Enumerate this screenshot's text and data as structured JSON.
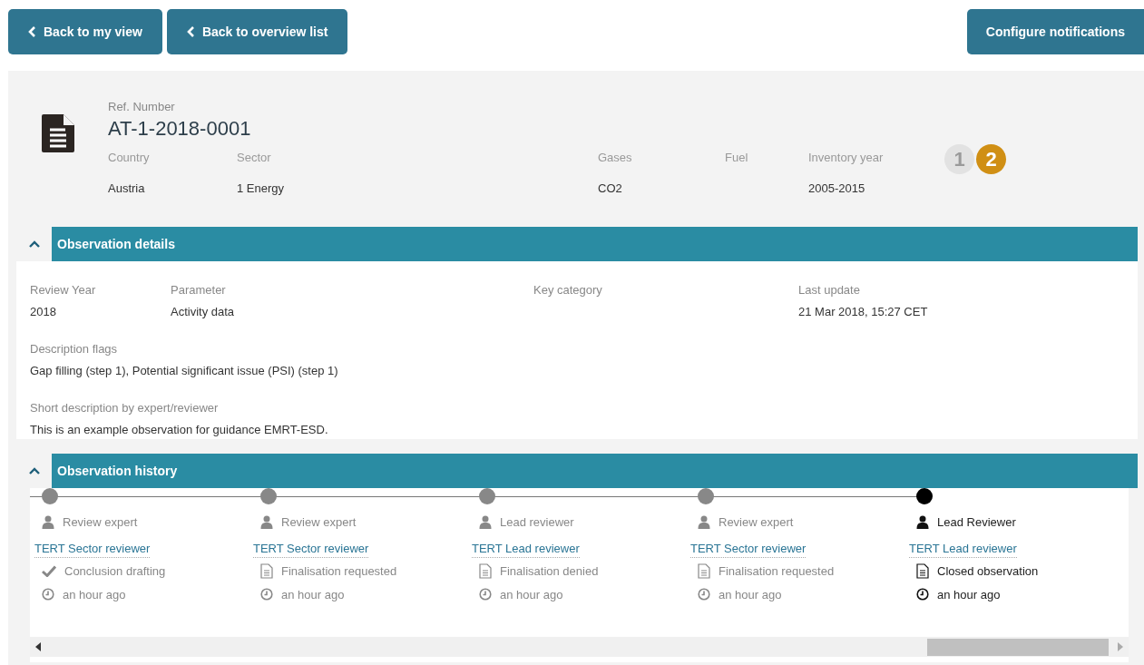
{
  "nav_buttons": [
    "Back to my view",
    "Back to overview list"
  ],
  "configure_button": "Configure notifications",
  "header": {
    "ref_label": "Ref. Number",
    "ref_number": "AT-1-2018-0001",
    "fields": [
      {
        "label": "Country",
        "value": "Austria"
      },
      {
        "label": "Sector",
        "value": "1 Energy"
      },
      {
        "label": "Gases",
        "value": "CO2"
      },
      {
        "label": "Fuel"
      },
      {
        "label": "Inventory year",
        "value": "2005-2015"
      }
    ],
    "steps": [
      {
        "label": "1",
        "selected": false
      },
      {
        "label": "2",
        "selected": true
      }
    ]
  },
  "details": {
    "title": "Observation details",
    "expanded": true,
    "fields": [
      {
        "label": "Review Year",
        "value": "2018"
      },
      {
        "label": "Parameter",
        "value": "Activity data"
      },
      {
        "label": "Key category"
      },
      {
        "label": "Last update",
        "value": "21 Mar 2018, 15:27 CET"
      }
    ],
    "flags_label": "Description flags",
    "flags": "Gap filling (step 1), Potential significant issue (PSI) (step 1)",
    "short_label": "Short description by expert/reviewer",
    "short": "This is an example observation for guidance EMRT-ESD."
  },
  "history": {
    "title": "Observation history",
    "expanded": true,
    "events": [
      {
        "role": "Review expert",
        "user": "TERT Sector reviewer",
        "kind": "check",
        "action": "Conclusion drafting",
        "time": "an hour ago",
        "selected": false
      },
      {
        "role": "Review expert",
        "user": "TERT Sector reviewer",
        "kind": "document",
        "action": "Finalisation requested",
        "time": "an hour ago",
        "selected": false
      },
      {
        "role": "Lead reviewer",
        "user": "TERT Lead reviewer",
        "kind": "document",
        "action": "Finalisation denied",
        "time": "an hour ago",
        "selected": false
      },
      {
        "role": "Review expert",
        "user": "TERT Sector reviewer",
        "kind": "document",
        "action": "Finalisation requested",
        "time": "an hour ago",
        "selected": false
      },
      {
        "role": "Lead Reviewer",
        "user": "TERT Lead reviewer",
        "kind": "document",
        "action": "Closed observation",
        "time": "an hour ago",
        "selected": true
      }
    ]
  }
}
